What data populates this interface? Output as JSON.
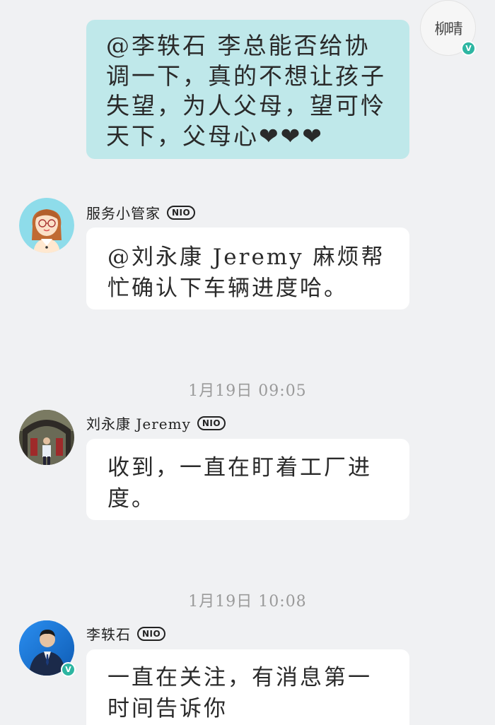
{
  "messages": [
    {
      "text": "@李轶石 李总能否给协调一下，真的不想让孩子失望，为人父母，望可怜天下，父母心❤❤❤"
    },
    {
      "sender": "服务小管家",
      "badge": "NIO",
      "text": "@刘永康 Jeremy 麻烦帮忙确认下车辆进度哈。"
    },
    {
      "time": "1月19日 09:05"
    },
    {
      "sender": "刘永康 Jeremy",
      "badge": "NIO",
      "text": "收到，一直在盯着工厂进度。"
    },
    {
      "time": "1月19日 10:08"
    },
    {
      "sender": "李轶石",
      "badge": "NIO",
      "text": "一直在关注，有消息第一时间告诉你"
    }
  ],
  "me": {
    "avatar_text": "柳晴",
    "verified": "V"
  },
  "verified_mark": "V",
  "colors": {
    "outgoing_bubble": "#bfe8ea",
    "incoming_bubble": "#ffffff",
    "background": "#f0f1f3",
    "verified": "#2eb6a2"
  }
}
